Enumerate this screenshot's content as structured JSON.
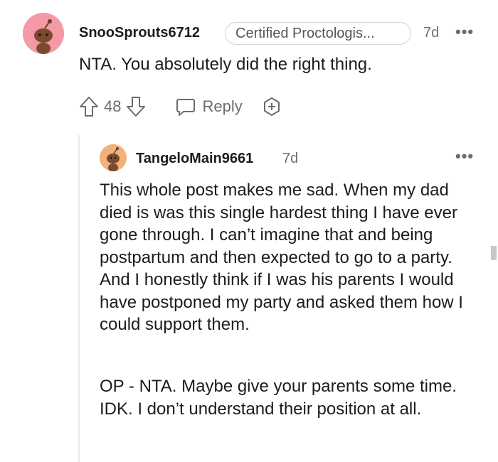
{
  "comment": {
    "username": "SnooSprouts6712",
    "flair": "Certified Proctologis...",
    "time": "7d",
    "more": "•••",
    "text": "NTA. You absolutely did the right thing.",
    "votes": "48",
    "reply_label": "Reply"
  },
  "reply": {
    "username": "TangeloMain9661",
    "time": "7d",
    "more": "•••",
    "paragraphs": [
      "This whole post makes me sad. When my dad died is was this single hardest thing I have ever gone through. I can’t imagine that and being postpartum and then expected to go to a party. And I honestly think if I was his parents I would have postponed my party and asked them how I could support them.",
      "OP - NTA. Maybe give your parents some time. IDK. I don’t understand their position at all."
    ]
  },
  "colors": {
    "avatar1": "#f49aa6",
    "avatar2": "#f3b07a",
    "meta_gray": "#6c6c6c",
    "thread_line": "#e6e8ea"
  },
  "icons": [
    "snoo-avatar-icon",
    "upvote-icon",
    "downvote-icon",
    "reply-bubble-icon",
    "award-icon",
    "more-options-icon"
  ]
}
